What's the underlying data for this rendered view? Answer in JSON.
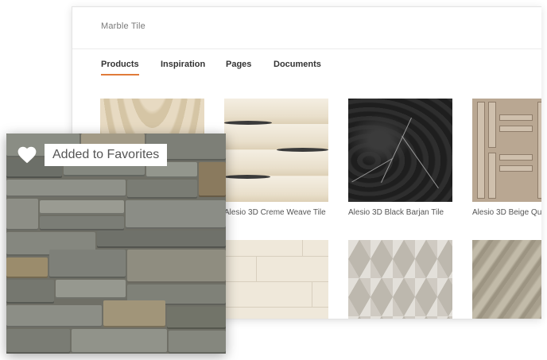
{
  "search": {
    "value": "Marble Tile"
  },
  "tabs": [
    {
      "label": "Products",
      "active": true
    },
    {
      "label": "Inspiration",
      "active": false
    },
    {
      "label": "Pages",
      "active": false
    },
    {
      "label": "Documents",
      "active": false
    }
  ],
  "products": [
    {
      "name": "",
      "texture": "cream-wave"
    },
    {
      "name": "Alesio 3D Creme Weave Tile",
      "texture": "creme-weave"
    },
    {
      "name": "Alesio 3D Black Barjan Tile",
      "texture": "black-barjan"
    },
    {
      "name": "Alesio 3D Beige Qu",
      "texture": "beige-lattice"
    },
    {
      "name": "",
      "texture": "white-brick"
    },
    {
      "name": "",
      "texture": "grey-cube"
    },
    {
      "name": "",
      "texture": "grey-marble"
    }
  ],
  "favorite_card": {
    "badge_text": "Added to Favorites",
    "icon": "heart-icon"
  },
  "colors": {
    "accent": "#e07b39",
    "text_dark": "#333333",
    "text_muted": "#7a7a7a"
  }
}
